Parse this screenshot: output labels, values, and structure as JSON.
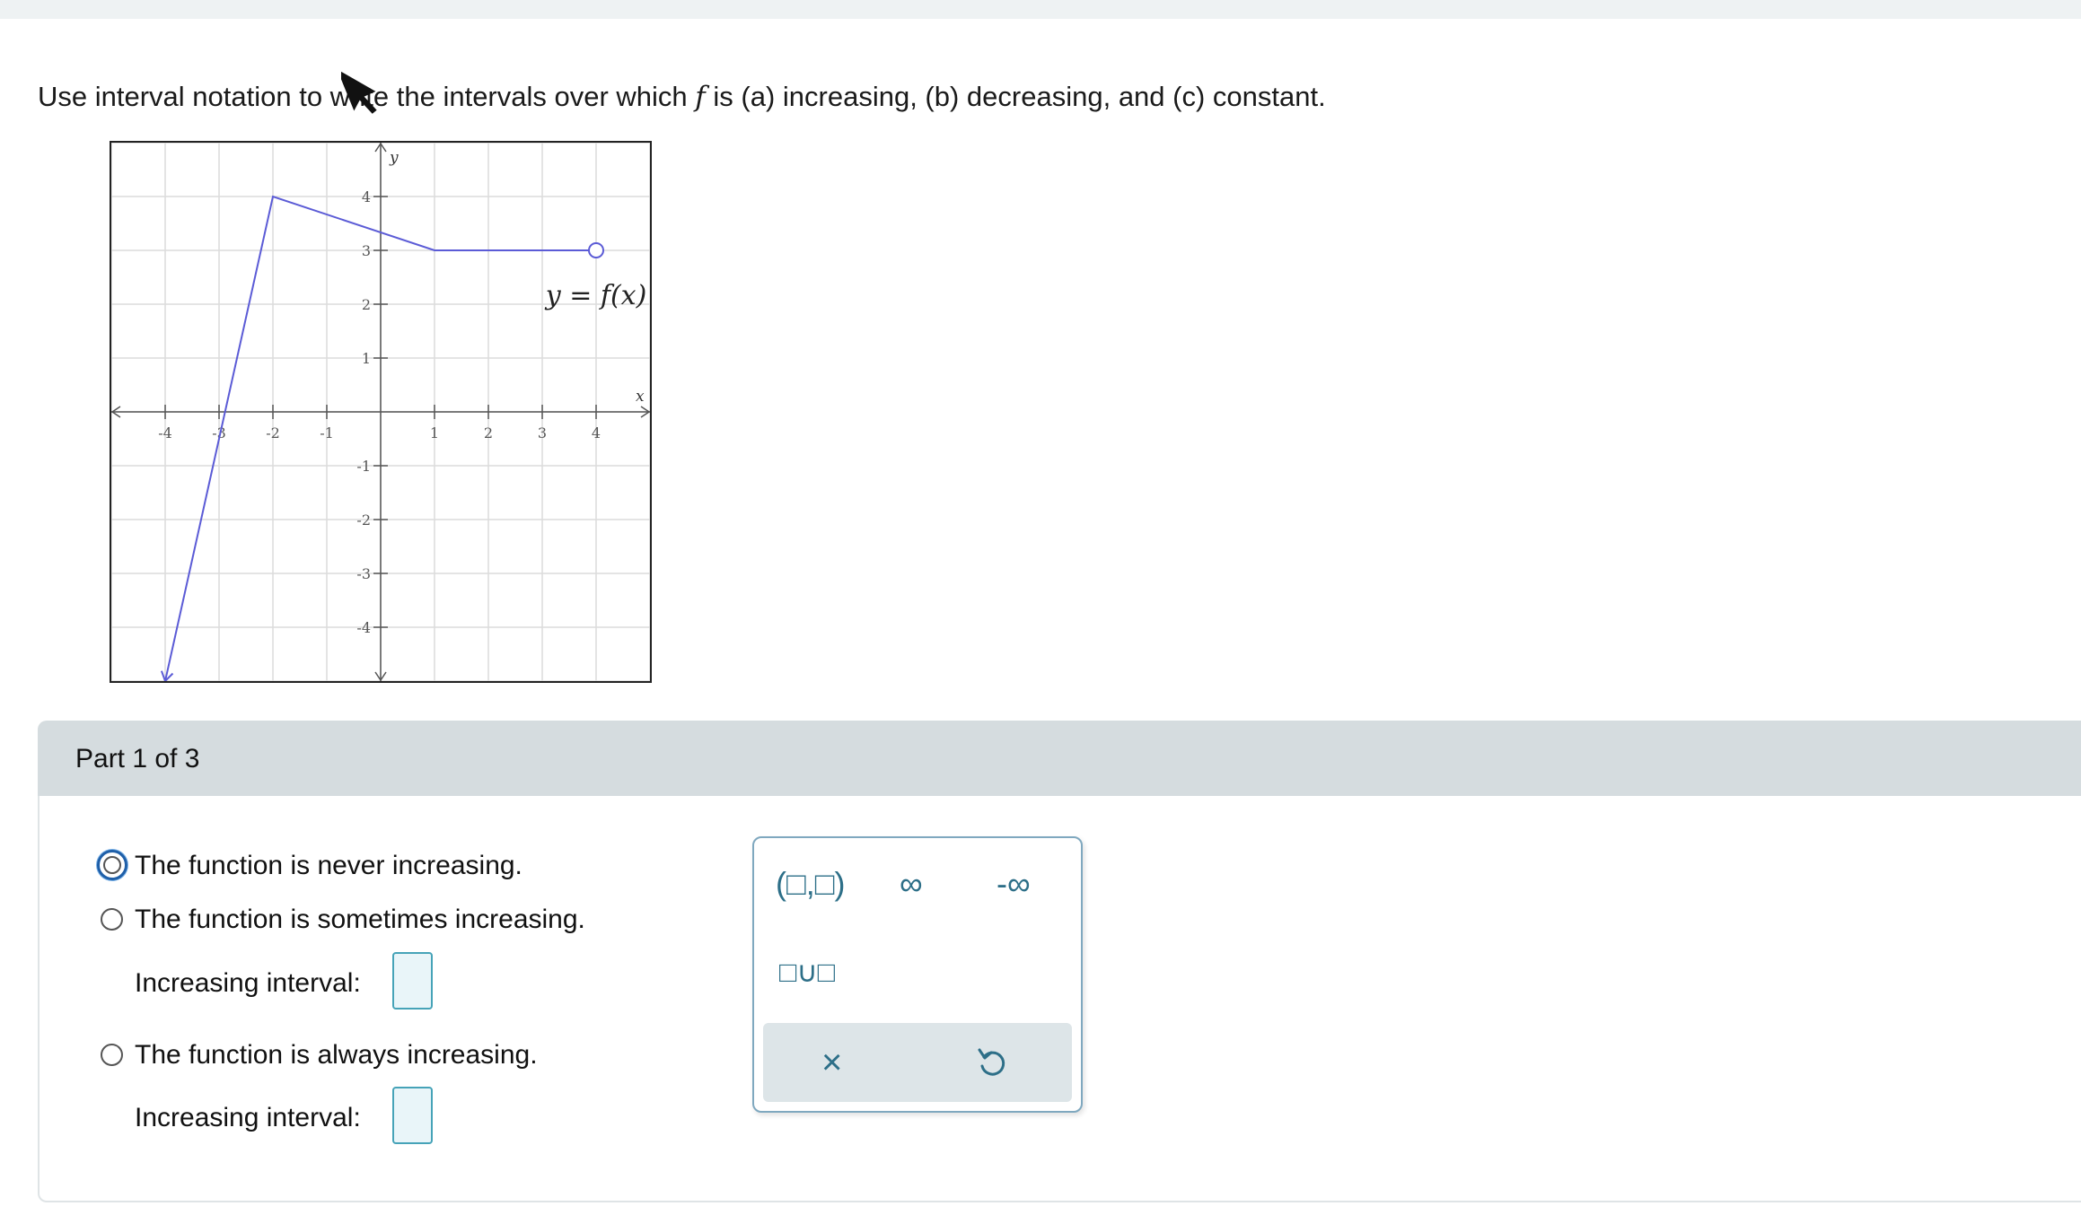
{
  "question": {
    "prefix": "Use interval notation to write the intervals over which",
    "var": "f",
    "suffix": "is (a) increasing, (b) decreasing, and (c) constant."
  },
  "graph": {
    "axis_x_label": "x",
    "axis_y_label": "y",
    "function_label": "y = f(x)",
    "x_ticks": [
      "-4",
      "-3",
      "-2",
      "-1",
      "1",
      "2",
      "3",
      "4"
    ],
    "y_ticks": [
      "4",
      "3",
      "2",
      "1",
      "-1",
      "-2",
      "-3",
      "-4"
    ],
    "curve_points": [
      [
        -4,
        -5
      ],
      [
        -2,
        4
      ],
      [
        1,
        3
      ],
      [
        4,
        3
      ]
    ],
    "open_endpoint": [
      4,
      3
    ],
    "line_color": "#5b5bd6"
  },
  "part": {
    "label": "Part 1 of 3"
  },
  "options": {
    "never": "The function is never increasing.",
    "sometimes": "The function is sometimes increasing.",
    "always": "The function is always increasing.",
    "interval_label": "Increasing interval:"
  },
  "palette": {
    "interval": "(□,□)",
    "infinity": "∞",
    "neg_infinity": "-∞",
    "union": "□∪□",
    "clear": "×"
  },
  "colors": {
    "accent": "#2d6f88",
    "header_bg": "#d5dcdf",
    "focus": "#1f5fa8"
  }
}
